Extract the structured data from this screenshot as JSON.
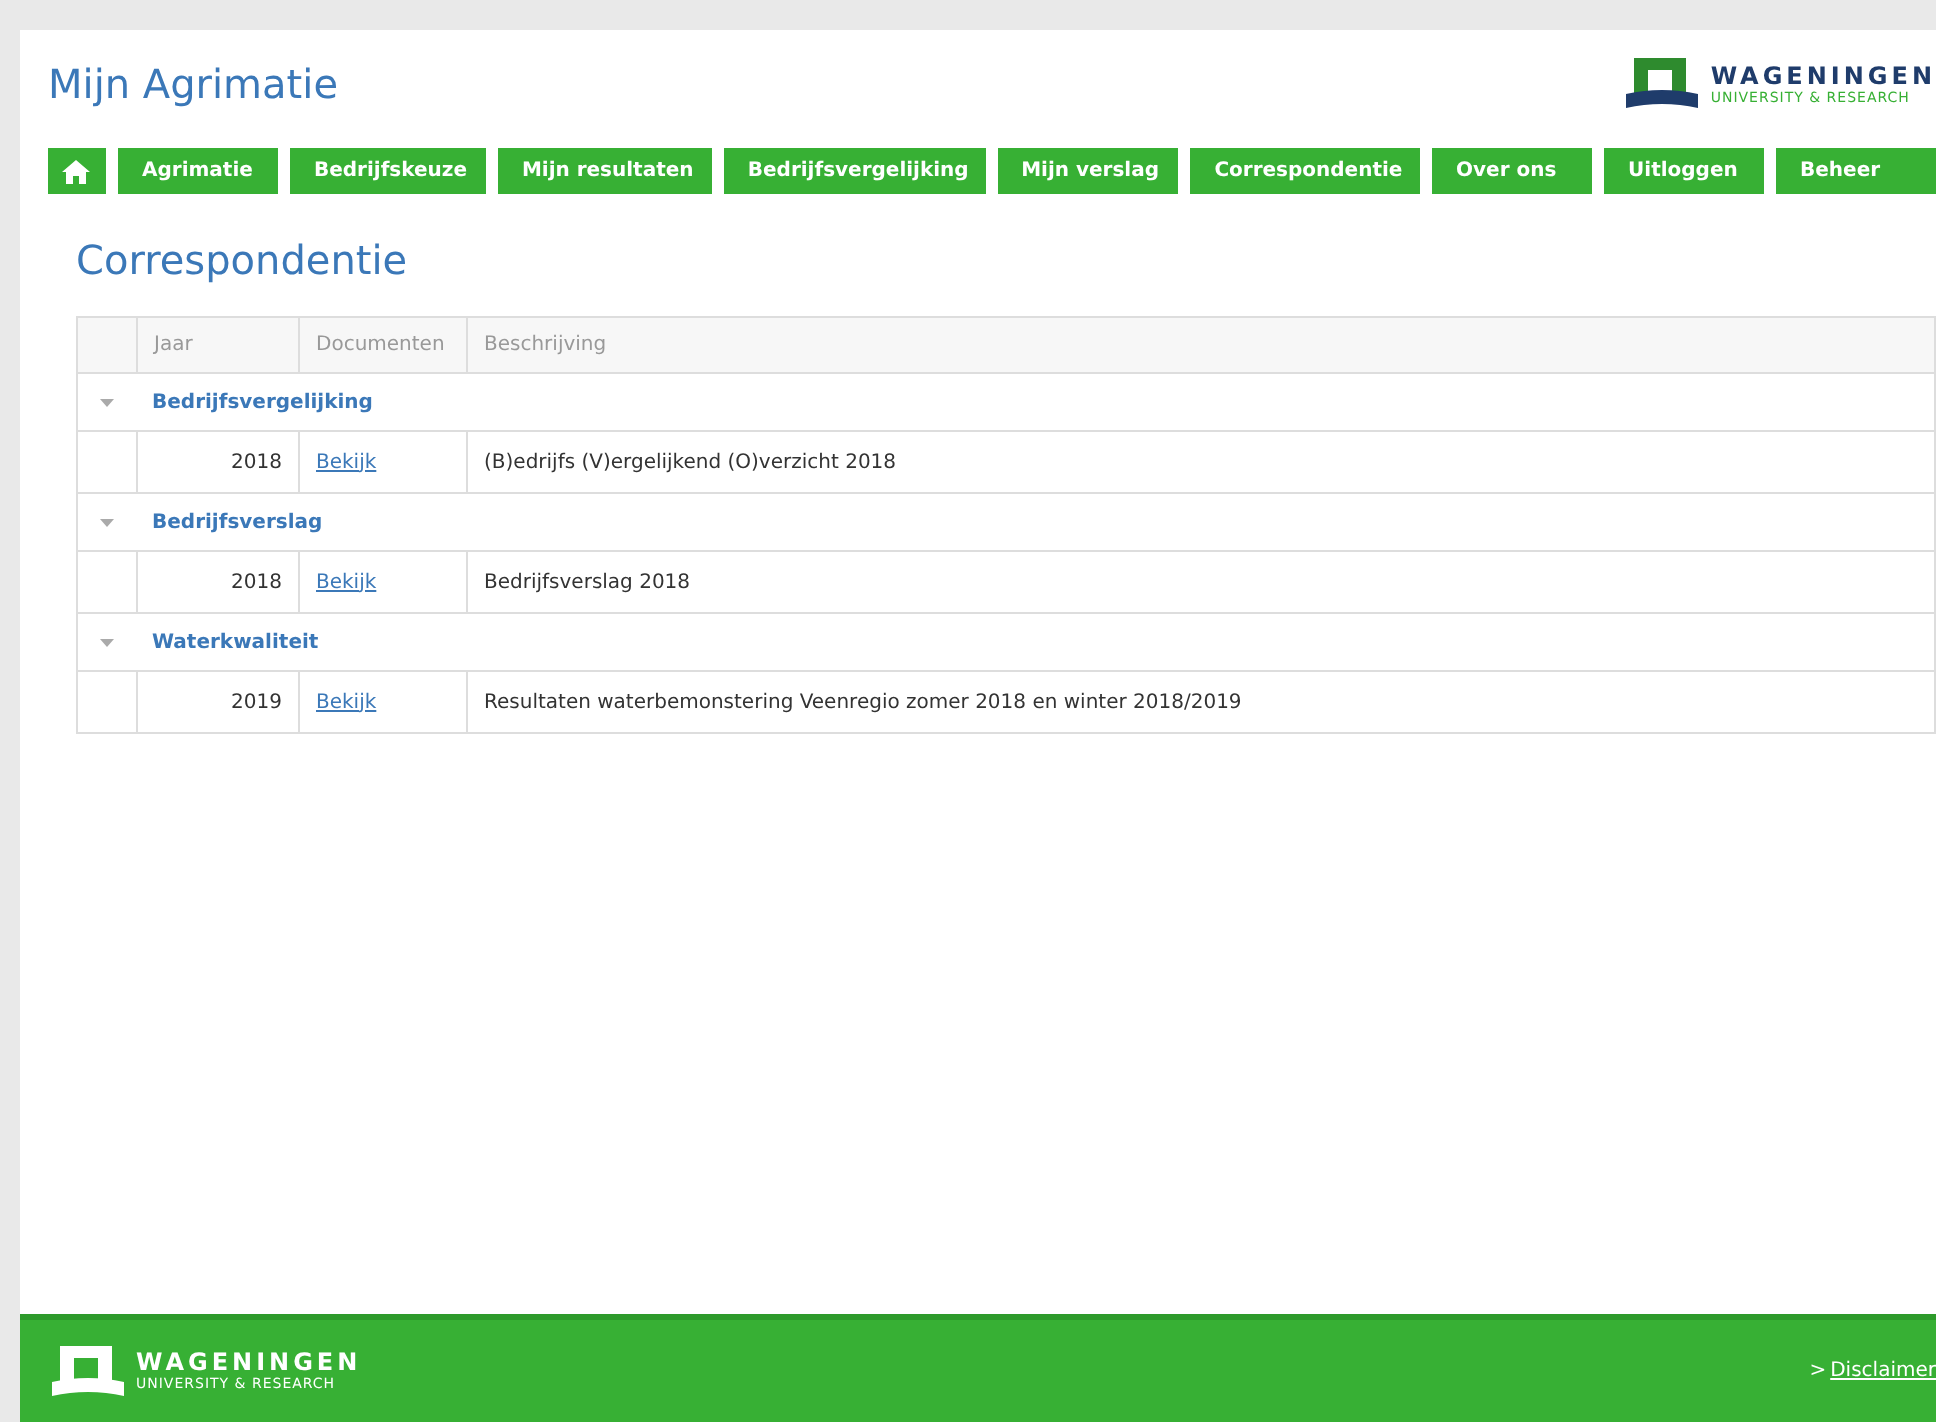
{
  "header": {
    "title": "Mijn Agrimatie",
    "logo": {
      "name": "WAGENINGEN",
      "subtitle": "UNIVERSITY & RESEARCH"
    }
  },
  "nav": [
    {
      "kind": "home"
    },
    {
      "kind": "text",
      "label": "Agrimatie"
    },
    {
      "kind": "text",
      "label": "Bedrijfskeuze"
    },
    {
      "kind": "text",
      "label": "Mijn resultaten"
    },
    {
      "kind": "text",
      "label": "Bedrijfsvergelijking"
    },
    {
      "kind": "text",
      "label": "Mijn verslag"
    },
    {
      "kind": "text",
      "label": "Correspondentie"
    },
    {
      "kind": "text",
      "label": "Over ons"
    },
    {
      "kind": "text",
      "label": "Uitloggen"
    },
    {
      "kind": "text",
      "label": "Beheer"
    }
  ],
  "page_title": "Correspondentie",
  "table": {
    "columns": [
      "Jaar",
      "Documenten",
      "Beschrijving"
    ],
    "groups": [
      {
        "title": "Bedrijfsvergelijking",
        "expanded": true,
        "rows": [
          {
            "year": "2018",
            "link": "Bekijk",
            "description": "(B)edrijfs (V)ergelijkend (O)verzicht 2018"
          }
        ]
      },
      {
        "title": "Bedrijfsverslag",
        "expanded": true,
        "rows": [
          {
            "year": "2018",
            "link": "Bekijk",
            "description": "Bedrijfsverslag 2018"
          }
        ]
      },
      {
        "title": "Waterkwaliteit",
        "expanded": true,
        "rows": [
          {
            "year": "2019",
            "link": "Bekijk",
            "description": "Resultaten waterbemonstering Veenregio zomer 2018 en winter 2018/2019"
          }
        ]
      }
    ]
  },
  "footer": {
    "logo": {
      "name": "WAGENINGEN",
      "subtitle": "UNIVERSITY & RESEARCH"
    },
    "link_prefix": ">",
    "link": "Disclaimer"
  }
}
